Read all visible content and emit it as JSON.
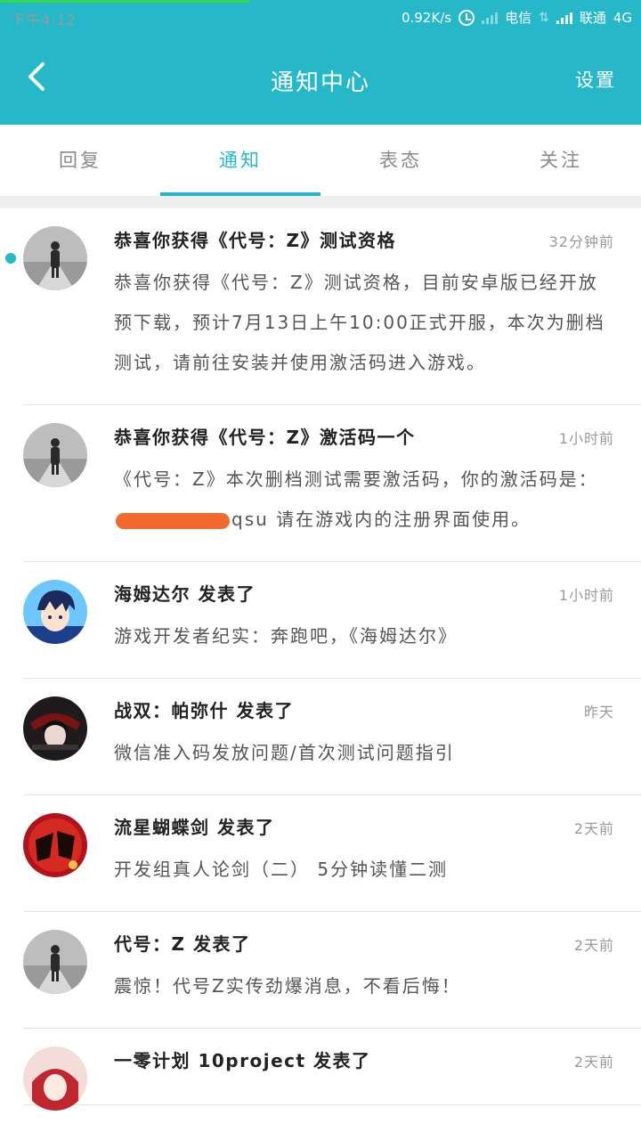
{
  "status_bar": {
    "time": "下午4:12",
    "speed": "0.92K/s",
    "carrier1": "电信",
    "carrier2": "联通",
    "network": "4G"
  },
  "header": {
    "title": "通知中心",
    "settings_label": "设置",
    "back_icon": "chevron-left-icon"
  },
  "tabs": [
    {
      "label": "回复",
      "active": false
    },
    {
      "label": "通知",
      "active": true
    },
    {
      "label": "表态",
      "active": false
    },
    {
      "label": "关注",
      "active": false
    }
  ],
  "accent_color": "#26b8c8",
  "notifications": [
    {
      "title": "恭喜你获得《代号：Z》测试资格",
      "time": "32分钟前",
      "unread": true,
      "body": "恭喜你获得《代号：Z》测试资格，目前安卓版已经开放预下载，预计7月13日上午10:00正式开服，本次为删档测试，请前往安装并使用激活码进入游戏。"
    },
    {
      "title": "恭喜你获得《代号：Z》激活码一个",
      "time": "1小时前",
      "unread": false,
      "body_before": "《代号：Z》本次删档测试需要激活码，你的激活码是：",
      "body_after": "qsu 请在游戏内的注册界面使用。"
    },
    {
      "title": "海姆达尔 发表了",
      "time": "1小时前",
      "unread": false,
      "body": "游戏开发者纪实：奔跑吧，《海姆达尔》"
    },
    {
      "title": "战双：帕弥什 发表了",
      "time": "昨天",
      "unread": false,
      "body": "微信准入码发放问题/首次测试问题指引"
    },
    {
      "title": "流星蝴蝶剑 发表了",
      "time": "2天前",
      "unread": false,
      "body": "开发组真人论剑（二） 5分钟读懂二测"
    },
    {
      "title": "代号：Z 发表了",
      "time": "2天前",
      "unread": false,
      "body": "震惊！代号Z实传劲爆消息，不看后悔！"
    },
    {
      "title": "一零计划 10project 发表了",
      "time": "2天前",
      "unread": false,
      "body": ""
    }
  ]
}
